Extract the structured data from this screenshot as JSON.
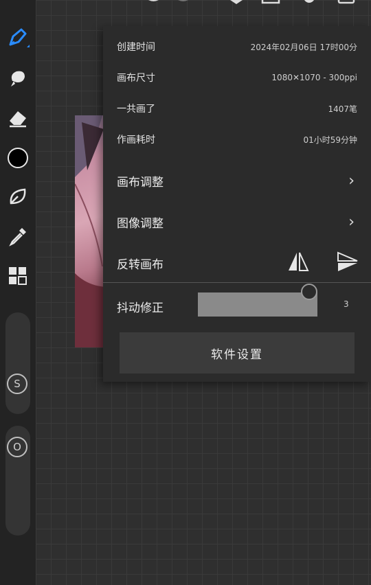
{
  "info": {
    "created_label": "创建时间",
    "created_value": "2024年02月06日 17时00分",
    "canvas_size_label": "画布尺寸",
    "canvas_size_value": "1080✕1070 - 300ppi",
    "strokes_label": "一共画了",
    "strokes_value": "1407笔",
    "time_label": "作画耗时",
    "time_value": "01小时59分钟"
  },
  "menu": {
    "canvas_adjust": "画布调整",
    "image_adjust": "图像调整",
    "flip_canvas": "反转画布",
    "stabilizer_label": "抖动修正",
    "stabilizer_value": "3",
    "settings_button": "软件设置"
  },
  "toolbar": {
    "brush_size_badge": "S",
    "opacity_badge": "O",
    "current_color": "#000000",
    "accent": "#2a8cff"
  }
}
